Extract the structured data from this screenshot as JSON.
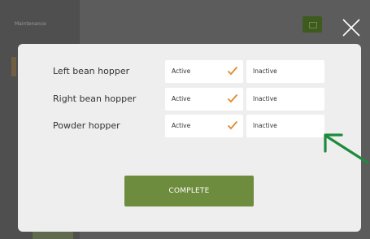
{
  "background": {
    "title": "Maintenance"
  },
  "dialog": {
    "rows": [
      {
        "label": "Left bean hopper",
        "active_label": "Active",
        "inactive_label": "Inactive",
        "selected": "active"
      },
      {
        "label": "Right bean hopper",
        "active_label": "Active",
        "inactive_label": "Inactive",
        "selected": "active"
      },
      {
        "label": "Powder hopper",
        "active_label": "Active",
        "inactive_label": "Inactive",
        "selected": "active"
      }
    ],
    "complete_label": "COMPLETE"
  },
  "icons": {
    "close": "close-icon",
    "check": "check-icon",
    "arrow": "arrow-icon"
  },
  "colors": {
    "accent_green": "#6e8c3d",
    "check_orange": "#e08a2e",
    "arrow_green": "#1e8a3c"
  }
}
